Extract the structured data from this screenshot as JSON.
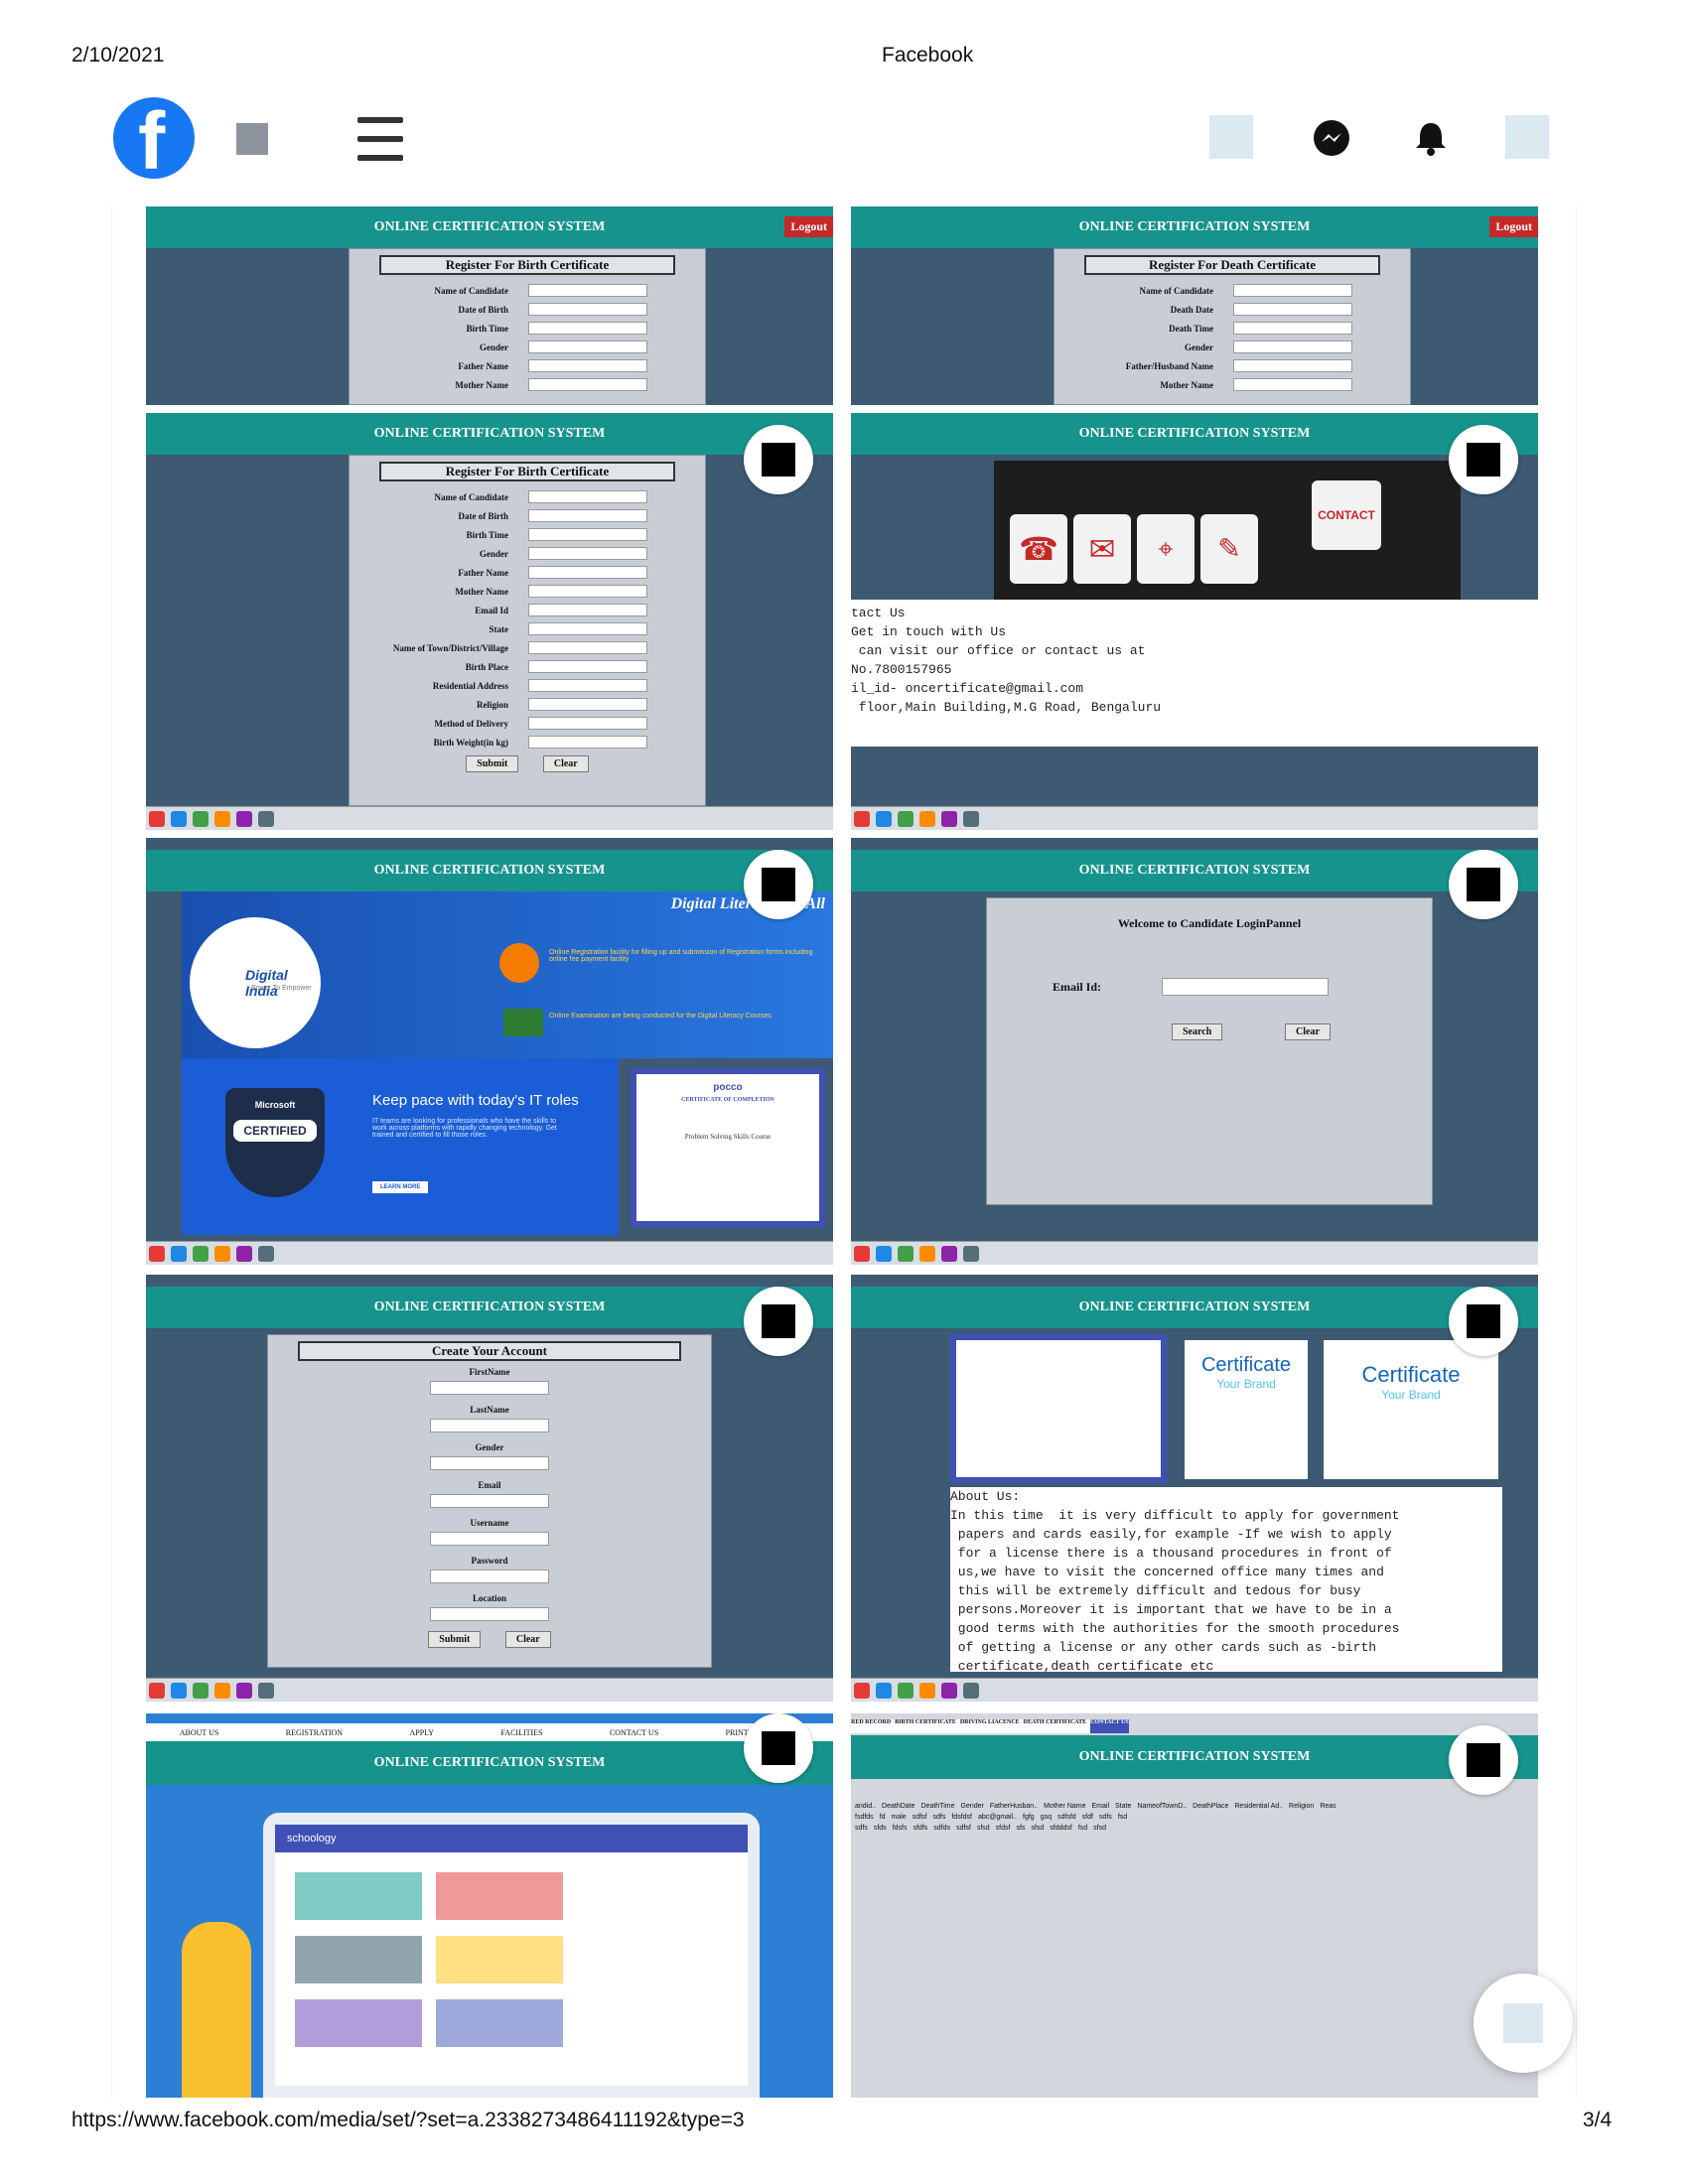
{
  "print_header": {
    "date": "2/10/2021",
    "title": "Facebook"
  },
  "print_footer": {
    "url": "https://www.facebook.com/media/set/?set=a.2338273486411192&type=3",
    "page": "3/4"
  },
  "nav": {
    "logo_letter": "f",
    "icons": [
      "photo-placeholder-icon",
      "messenger-icon",
      "notifications-bell-icon",
      "photo-placeholder-icon"
    ]
  },
  "app": {
    "system_title": "ONLINE CERTIFICATION SYSTEM",
    "logout": "Logout",
    "birth_form": {
      "title": "Register For Birth Certificate",
      "fields_short": [
        "Name of Candidate",
        "Date of Birth",
        "Birth Time",
        "Gender",
        "Father Name",
        "Mother Name"
      ],
      "fields_full": [
        "Name of Candidate",
        "Date of Birth",
        "Birth Time",
        "Gender",
        "Father Name",
        "Mother Name",
        "Email Id",
        "State",
        "Name of Town/District/Village",
        "Birth Place",
        "Residential Address",
        "Religion",
        "Method of Delivery",
        "Birth Weight(in kg)"
      ],
      "submit": "Submit",
      "clear": "Clear"
    },
    "death_form": {
      "title": "Register For Death Certificate",
      "fields": [
        "Name of Candidate",
        "Death Date",
        "Death Time",
        "Gender",
        "Father/Husband Name",
        "Mother Name"
      ]
    },
    "contact": {
      "badge": "CONTACT",
      "lines": [
        "tact Us",
        "Get in touch with Us",
        " can visit our office or contact us at",
        "No.7800157965",
        "il_id- oncertificate@gmail.com",
        " floor,Main Building,M.G Road, Bengaluru"
      ]
    },
    "digital": {
      "banner": "Digital Literacy For All",
      "logo": "Digital India",
      "logo_sub": "Power To Empower",
      "reg_text": "Online Registration facility for filling up and submission of Registration forms including online fee payment facility",
      "exam_text": "Online Examination are being conducted for the Digital Literacy Courses",
      "ms_brand": "Microsoft",
      "ms_badge": "CERTIFIED",
      "ms_headline": "Keep pace with today's IT roles",
      "ms_body": "IT teams are looking for professionals who have the skills to work across platforms with rapidly changing technology. Get trained and certified to fill those roles.",
      "ms_button": "LEARN MORE",
      "cert_brand": "pocco",
      "cert_title": "CERTIFICATE OF COMPLETION",
      "cert_course": "Problem Solving Skills Course"
    },
    "login": {
      "welcome": "Welcome to Candidate LoginPannel",
      "email_label": "Email Id:",
      "search": "Search",
      "clear": "Clear"
    },
    "account": {
      "title": "Create Your Account",
      "fields": [
        "FirstName",
        "LastName",
        "Gender",
        "Email",
        "Username",
        "Password",
        "Location"
      ],
      "submit": "Submit",
      "clear": "Clear"
    },
    "about": {
      "cert_left": "Certificate",
      "cert_right": "Certificate",
      "your_brand": "Your Brand",
      "lines": [
        "About Us:",
        "In this time  it is very difficult to apply for government",
        " papers and cards easily,for example -If we wish to apply",
        " for a license there is a thousand procedures in front of",
        " us,we have to visit the concerned office many times and",
        " this will be extremely difficult and tedous for busy",
        " persons.Moreover it is important that we have to be in a",
        " good terms with the authorities for the smooth procedures",
        " of getting a license or any other cards such as -birth",
        " certificate,death certificate etc"
      ]
    },
    "menu": {
      "items": [
        "ABOUT US",
        "REGISTRATION",
        "APPLY",
        "FACILITIES",
        "CONTACT US",
        "PRINT CERTIFICATE"
      ],
      "brand": "schoology"
    },
    "records": {
      "tabs": [
        "RED RECORD",
        "BIRTH CERTIFICATE",
        "DRIVING LIACENCE",
        "DEATH CERTIFICATE",
        "CONTACT US"
      ],
      "headers": [
        "andid..",
        "DeathDate",
        "DeathTime",
        "Gender",
        "FatherHusban..",
        "Mother Name",
        "Email",
        "State",
        "NameofTownD..",
        "DeathPlace",
        "Residential Ad..",
        "Religion",
        "Reas"
      ],
      "row1": [
        "fsdfds",
        "fd",
        "male",
        "sdfsf",
        "sdfs",
        "fdsfdsf",
        "abc@gmail..",
        "fgfg",
        "gsq",
        "sdfsfd",
        "sfdf",
        "sdfs",
        "fsd"
      ],
      "row2": [
        "sdfs",
        "sfds",
        "fdsfs",
        "sfdfs",
        "sdfds",
        "sdfsf",
        "sfsd",
        "sfdsf",
        "sfs",
        "sfsd",
        "sfdddsf",
        "fsd",
        "sfsd"
      ]
    }
  }
}
